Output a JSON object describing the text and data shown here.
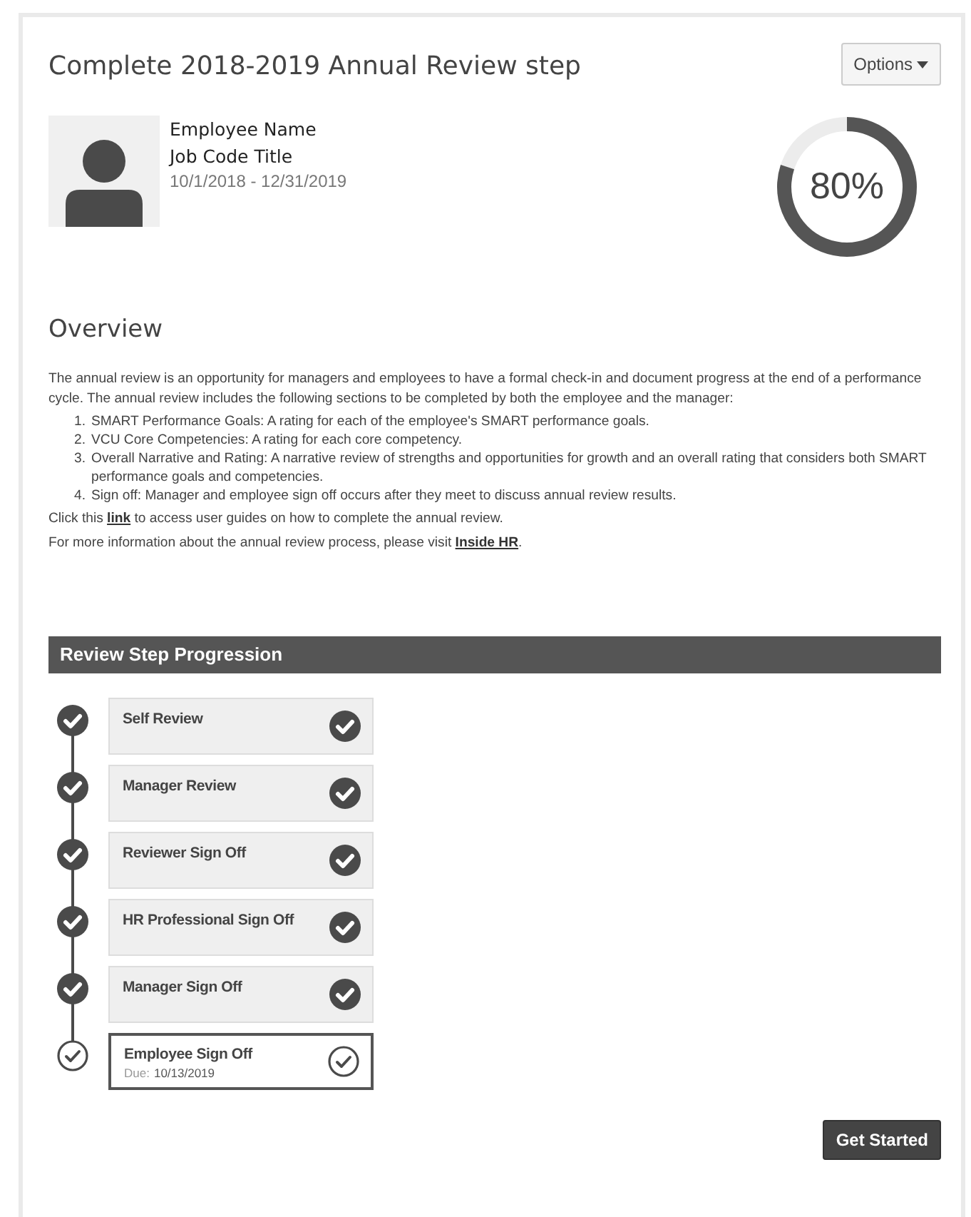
{
  "title": "Complete 2018-2019 Annual Review step",
  "options_button": {
    "label": "Options"
  },
  "employee": {
    "name": "Employee Name",
    "job_title": "Job Code Title",
    "period": "10/1/2018 - 12/31/2019"
  },
  "progress": {
    "level": 0.8,
    "reading": "80%"
  },
  "overview": {
    "heading": "Overview",
    "intro": "The annual review is an opportunity for managers and employees to have a formal check-in and document progress at the end of a performance cycle. The annual review includes the following sections to be completed by both the employee and the manager:",
    "sections": [
      {
        "number": "1.",
        "text": "SMART Performance Goals: A rating for each of the employee's SMART performance goals."
      },
      {
        "number": "2.",
        "text": "VCU Core Competencies: A rating for each core competency."
      },
      {
        "number": "3.",
        "text": "Overall Narrative and Rating: A narrative review of strengths and opportunities for growth and an overall rating that considers both SMART performance goals and competencies."
      },
      {
        "number": "4.",
        "text": "Sign off: Manager and employee sign off occurs after they meet to discuss annual review results."
      }
    ],
    "guide_line": {
      "before": "Click this ",
      "link": "link",
      "after": " to access user guides on how to complete the annual review."
    },
    "info_line": {
      "before": "For more information about the annual review process, please visit ",
      "link": "Inside HR",
      "after": "."
    }
  },
  "progression": {
    "heading": "Review Step Progression",
    "steps": [
      {
        "label": "Self Review",
        "completed": true
      },
      {
        "label": "Manager Review",
        "completed": true
      },
      {
        "label": "Reviewer Sign Off",
        "completed": true
      },
      {
        "label": "HR Professional Sign Off",
        "completed": true
      },
      {
        "label": "Manager Sign Off",
        "completed": true
      },
      {
        "label": "Employee Sign Off",
        "completed": false,
        "due_label": "Due:",
        "due_date": "10/13/2019"
      }
    ]
  },
  "start_button": {
    "label": "Get Started"
  }
}
